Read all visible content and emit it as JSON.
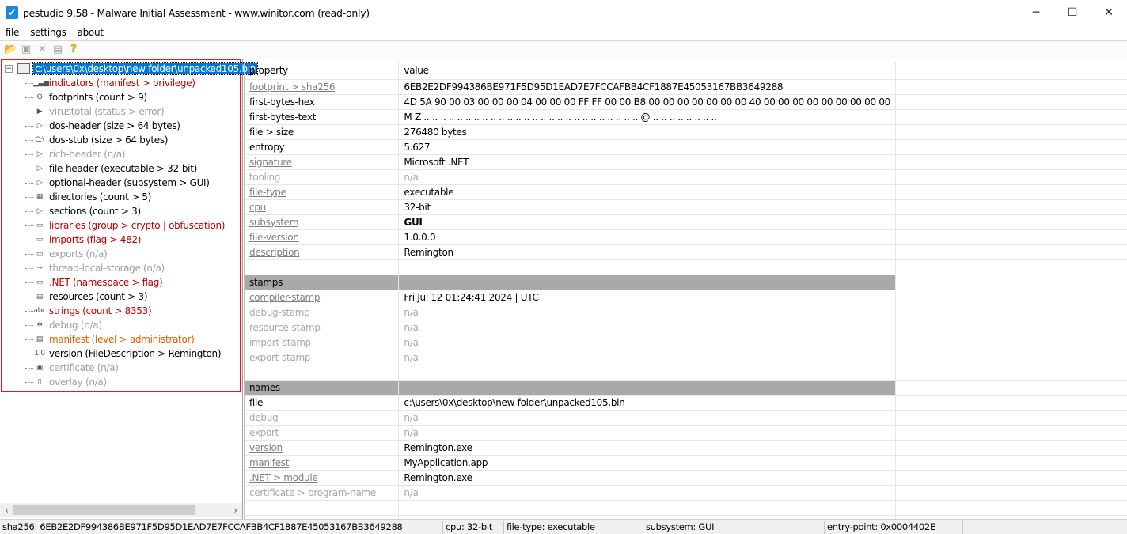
{
  "window": {
    "title": "pestudio 9.58 - Malware Initial Assessment - www.winitor.com (read-only)",
    "minimize": "─",
    "maximize": "☐",
    "close": "✕"
  },
  "menu": [
    "file",
    "settings",
    "about"
  ],
  "toolbar": [
    {
      "name": "open-icon",
      "glyph": "📂"
    },
    {
      "name": "save-icon",
      "glyph": "▣"
    },
    {
      "name": "close-file-icon",
      "glyph": "✕"
    },
    {
      "name": "clipboard-icon",
      "glyph": "▤"
    },
    {
      "name": "help-icon",
      "glyph": "?"
    }
  ],
  "tree": {
    "root": "c:\\users\\0x\\desktop\\new folder\\unpacked105.bin",
    "items": [
      {
        "label": "indicators (manifest > privilege)",
        "color": "red",
        "icon": "indicators-icon",
        "glyph": "▁▃▅"
      },
      {
        "label": "footprints (count > 9)",
        "color": "black",
        "icon": "footprints-icon",
        "glyph": "ʘ"
      },
      {
        "label": "virustotal (status > error)",
        "color": "grey",
        "icon": "virustotal-icon",
        "glyph": "▶"
      },
      {
        "label": "dos-header (size > 64 bytes)",
        "color": "black",
        "icon": "arrow-icon",
        "glyph": "▷"
      },
      {
        "label": "dos-stub (size > 64 bytes)",
        "color": "black",
        "icon": "console-icon",
        "glyph": "C:\\"
      },
      {
        "label": "rich-header (n/a)",
        "color": "grey",
        "icon": "arrow-icon",
        "glyph": "▷"
      },
      {
        "label": "file-header (executable > 32-bit)",
        "color": "black",
        "icon": "arrow-icon",
        "glyph": "▷"
      },
      {
        "label": "optional-header (subsystem > GUI)",
        "color": "black",
        "icon": "arrow-icon",
        "glyph": "▷"
      },
      {
        "label": "directories (count > 5)",
        "color": "black",
        "icon": "directories-icon",
        "glyph": "▦"
      },
      {
        "label": "sections (count > 3)",
        "color": "black",
        "icon": "arrow-icon",
        "glyph": "▷"
      },
      {
        "label": "libraries (group > crypto | obfuscation)",
        "color": "red",
        "icon": "libraries-icon",
        "glyph": "▭"
      },
      {
        "label": "imports (flag > 482)",
        "color": "red",
        "icon": "imports-icon",
        "glyph": "▭"
      },
      {
        "label": "exports (n/a)",
        "color": "grey",
        "icon": "exports-icon",
        "glyph": "▭"
      },
      {
        "label": "thread-local-storage (n/a)",
        "color": "grey",
        "icon": "tls-icon",
        "glyph": "⊸"
      },
      {
        "label": ".NET (namespace > flag)",
        "color": "red",
        "icon": "dotnet-icon",
        "glyph": "▭"
      },
      {
        "label": "resources (count > 3)",
        "color": "black",
        "icon": "resources-icon",
        "glyph": "▤"
      },
      {
        "label": "strings (count > 8353)",
        "color": "red",
        "icon": "strings-icon",
        "glyph": "abc"
      },
      {
        "label": "debug (n/a)",
        "color": "grey",
        "icon": "debug-bug-icon",
        "glyph": "✲"
      },
      {
        "label": "manifest (level > administrator)",
        "color": "orange",
        "icon": "manifest-icon",
        "glyph": "▤"
      },
      {
        "label": "version (FileDescription > Remington)",
        "color": "black",
        "icon": "version-icon",
        "glyph": "1.0"
      },
      {
        "label": "certificate (n/a)",
        "color": "grey",
        "icon": "certificate-icon",
        "glyph": "▣"
      },
      {
        "label": "overlay (n/a)",
        "color": "grey",
        "icon": "overlay-page-icon",
        "glyph": "▯"
      }
    ]
  },
  "table": {
    "header": {
      "property": "property",
      "value": "value"
    },
    "rows": [
      {
        "property": "footprint > sha256",
        "value": "6EB2E2DF994386BE971F5D95D1EAD7E7FCCAFBB4CF1887E45053167BB3649288",
        "style": "link"
      },
      {
        "property": "first-bytes-hex",
        "value": "4D 5A 90 00 03 00 00 00 04 00 00 00 FF FF 00 00 B8 00 00 00 00 00 00 00 40 00 00 00 00 00 00 00 00 00",
        "style": "plain"
      },
      {
        "property": "first-bytes-text",
        "value": "M Z .. .. .. .. .. .. .. .. .. .. .. .. .. .. .. .. .. .. .. .. .. .. .. .. .. .. @ .. .. .. .. .. .. .. ..",
        "style": "plain"
      },
      {
        "property": "file > size",
        "value": "276480 bytes",
        "style": "plain"
      },
      {
        "property": "entropy",
        "value": "5.627",
        "style": "plain"
      },
      {
        "property": "signature",
        "value": "Microsoft .NET",
        "style": "link"
      },
      {
        "property": "tooling",
        "value": "n/a",
        "style": "na"
      },
      {
        "property": "file-type",
        "value": "executable",
        "style": "link"
      },
      {
        "property": "cpu",
        "value": "32-bit",
        "style": "link"
      },
      {
        "property": "subsystem",
        "value": "GUI",
        "style": "link-bold"
      },
      {
        "property": "file-version",
        "value": "1.0.0.0",
        "style": "link"
      },
      {
        "property": "description",
        "value": "Remington",
        "style": "link"
      },
      {
        "property": "",
        "value": "",
        "style": "blank"
      },
      {
        "property": "stamps",
        "value": "",
        "style": "section"
      },
      {
        "property": "compiler-stamp",
        "value": "Fri Jul 12 01:24:41 2024 | UTC",
        "style": "link"
      },
      {
        "property": "debug-stamp",
        "value": "n/a",
        "style": "na"
      },
      {
        "property": "resource-stamp",
        "value": "n/a",
        "style": "na"
      },
      {
        "property": "import-stamp",
        "value": "n/a",
        "style": "na"
      },
      {
        "property": "export-stamp",
        "value": "n/a",
        "style": "na"
      },
      {
        "property": "",
        "value": "",
        "style": "blank"
      },
      {
        "property": "names",
        "value": "",
        "style": "section"
      },
      {
        "property": "file",
        "value": "c:\\users\\0x\\desktop\\new folder\\unpacked105.bin",
        "style": "plain"
      },
      {
        "property": "debug",
        "value": "n/a",
        "style": "na"
      },
      {
        "property": "export",
        "value": "n/a",
        "style": "na"
      },
      {
        "property": "version",
        "value": "Remington.exe",
        "style": "link"
      },
      {
        "property": "manifest",
        "value": "MyApplication.app",
        "style": "link"
      },
      {
        "property": ".NET > module",
        "value": "Remington.exe",
        "style": "link"
      },
      {
        "property": "certificate > program-name",
        "value": "n/a",
        "style": "na"
      },
      {
        "property": "",
        "value": "",
        "style": "blank"
      },
      {
        "property": "",
        "value": "",
        "style": "blank"
      }
    ]
  },
  "statusbar": {
    "sha256": "sha256: 6EB2E2DF994386BE971F5D95D1EAD7E7FCCAFBB4CF1887E45053167BB3649288",
    "cpu": "cpu: 32-bit",
    "filetype": "file-type: executable",
    "subsystem": "subsystem: GUI",
    "entrypoint": "entry-point: 0x0004402E"
  },
  "colors": {
    "selection": "#0078d7",
    "highlight_border": "#e8141e",
    "red": "#c00000",
    "orange": "#e06000",
    "grey": "#a0a0a0",
    "section": "#a9a9a9"
  }
}
